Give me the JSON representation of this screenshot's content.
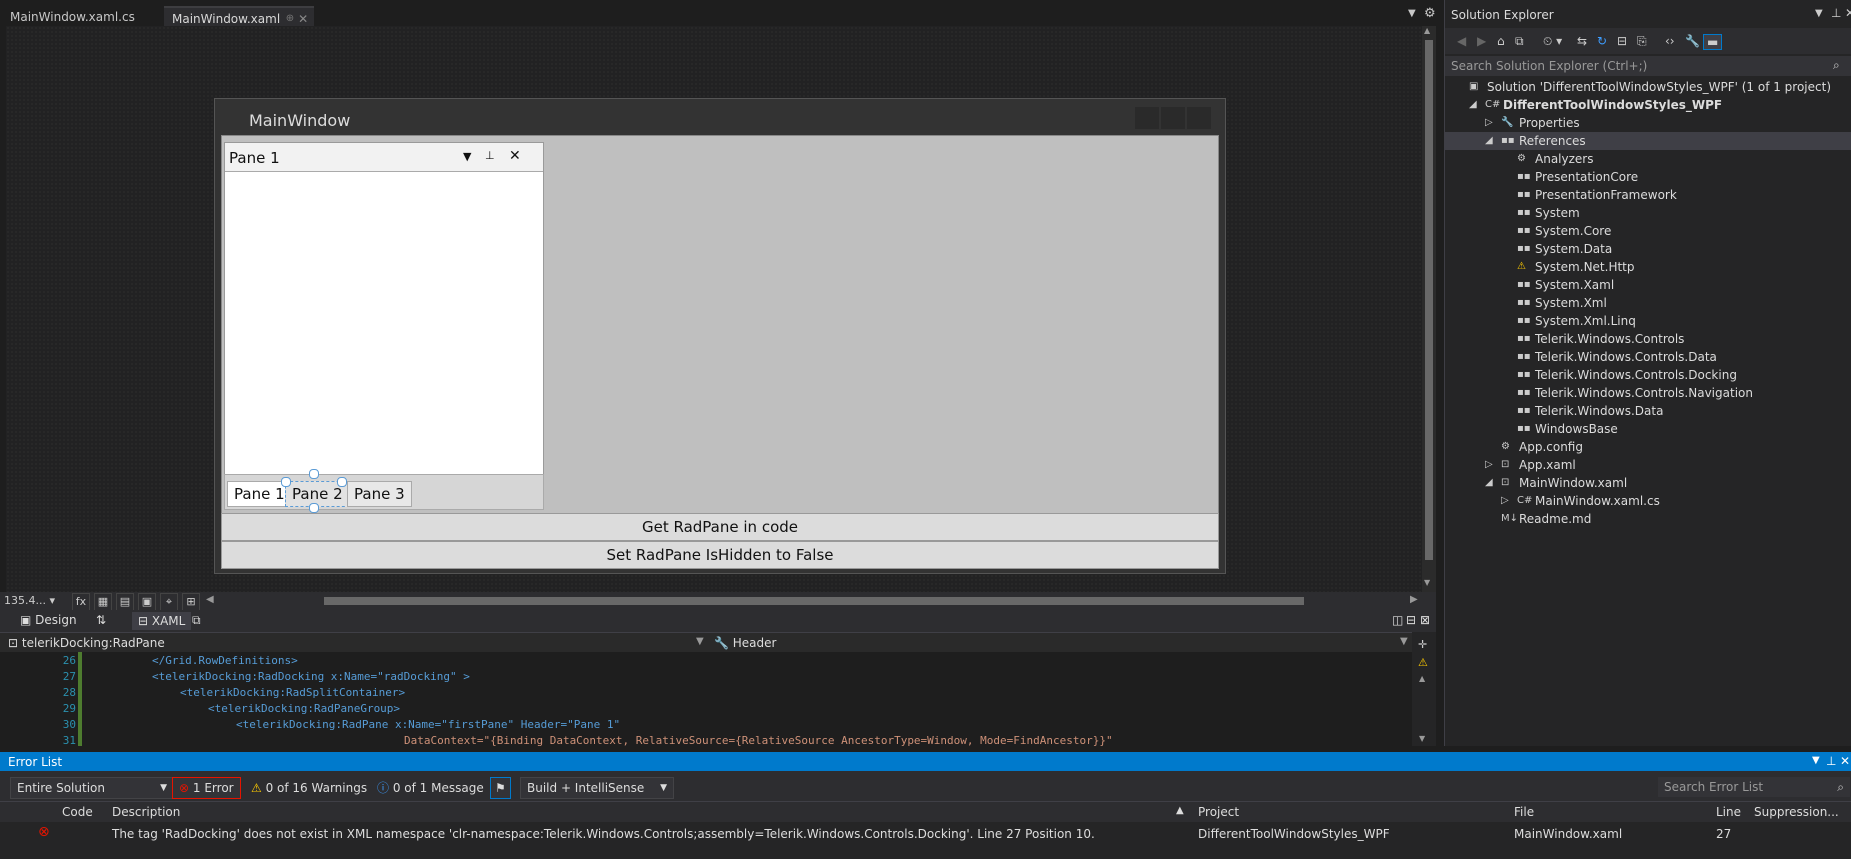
{
  "tabs": [
    {
      "label": "MainWindow.xaml.cs"
    },
    {
      "label": "MainWindow.xaml",
      "pin": "⊕",
      "close": "✕"
    }
  ],
  "designer": {
    "window_title": "MainWindow",
    "pane": {
      "title": "Pane 1",
      "menu": "▼",
      "pin": "📌",
      "close": "✕"
    },
    "pane_tabs": [
      "Pane 1",
      "Pane 2",
      "Pane 3"
    ],
    "buttons": [
      "Get RadPane in code",
      "Set RadPane IsHidden to False"
    ]
  },
  "zoom": "135.4...",
  "view_tabs": {
    "design": "Design",
    "swap": "⇅",
    "xaml": "XAML"
  },
  "path_bar": {
    "element": "telerikDocking:RadPane",
    "property": "Header"
  },
  "code_lines": [
    {
      "num": "26",
      "text": "</Grid.RowDefinitions>"
    },
    {
      "num": "27",
      "text": "<telerikDocking:RadDocking x:Name=\"radDocking\" >"
    },
    {
      "num": "28",
      "text": "<telerikDocking:RadSplitContainer>"
    },
    {
      "num": "29",
      "text": "<telerikDocking:RadPaneGroup>"
    },
    {
      "num": "30",
      "text": "<telerikDocking:RadPane x:Name=\"firstPane\" Header=\"Pane 1\""
    },
    {
      "num": "31",
      "text": "DataContext=\"{Binding DataContext, RelativeSource={RelativeSource AncestorType=Window, Mode=FindAncestor}}\""
    }
  ],
  "solution_explorer": {
    "title": "Solution Explorer",
    "search_placeholder": "Search Solution Explorer (Ctrl+;)",
    "tree": [
      {
        "label": "Solution 'DifferentToolWindowStyles_WPF' (1 of 1 project)",
        "level": 0,
        "icon": "solution-icon",
        "expander": ""
      },
      {
        "label": "DifferentToolWindowStyles_WPF",
        "level": 1,
        "icon": "csharp-project-icon",
        "expander": "◢",
        "bold": true
      },
      {
        "label": "Properties",
        "level": 2,
        "icon": "wrench-icon",
        "expander": "▷"
      },
      {
        "label": "References",
        "level": 2,
        "icon": "references-icon",
        "expander": "◢",
        "selected": true
      },
      {
        "label": "Analyzers",
        "level": 3,
        "icon": "analyzer-icon",
        "expander": ""
      },
      {
        "label": "PresentationCore",
        "level": 3,
        "icon": "reference-icon",
        "expander": ""
      },
      {
        "label": "PresentationFramework",
        "level": 3,
        "icon": "reference-icon",
        "expander": ""
      },
      {
        "label": "System",
        "level": 3,
        "icon": "reference-icon",
        "expander": ""
      },
      {
        "label": "System.Core",
        "level": 3,
        "icon": "reference-icon",
        "expander": ""
      },
      {
        "label": "System.Data",
        "level": 3,
        "icon": "reference-icon",
        "expander": ""
      },
      {
        "label": "System.Net.Http",
        "level": 3,
        "icon": "warning-reference-icon",
        "expander": ""
      },
      {
        "label": "System.Xaml",
        "level": 3,
        "icon": "reference-icon",
        "expander": ""
      },
      {
        "label": "System.Xml",
        "level": 3,
        "icon": "reference-icon",
        "expander": ""
      },
      {
        "label": "System.Xml.Linq",
        "level": 3,
        "icon": "reference-icon",
        "expander": ""
      },
      {
        "label": "Telerik.Windows.Controls",
        "level": 3,
        "icon": "reference-icon",
        "expander": ""
      },
      {
        "label": "Telerik.Windows.Controls.Data",
        "level": 3,
        "icon": "reference-icon",
        "expander": ""
      },
      {
        "label": "Telerik.Windows.Controls.Docking",
        "level": 3,
        "icon": "reference-icon",
        "expander": ""
      },
      {
        "label": "Telerik.Windows.Controls.Navigation",
        "level": 3,
        "icon": "reference-icon",
        "expander": ""
      },
      {
        "label": "Telerik.Windows.Data",
        "level": 3,
        "icon": "reference-icon",
        "expander": ""
      },
      {
        "label": "WindowsBase",
        "level": 3,
        "icon": "reference-icon",
        "expander": ""
      },
      {
        "label": "App.config",
        "level": 2,
        "icon": "config-file-icon",
        "expander": ""
      },
      {
        "label": "App.xaml",
        "level": 2,
        "icon": "xaml-file-icon",
        "expander": "▷"
      },
      {
        "label": "MainWindow.xaml",
        "level": 2,
        "icon": "xaml-file-icon",
        "expander": "◢"
      },
      {
        "label": "MainWindow.xaml.cs",
        "level": 3,
        "icon": "csharp-file-icon",
        "expander": "▷"
      },
      {
        "label": "Readme.md",
        "level": 2,
        "icon": "markdown-file-icon",
        "expander": ""
      }
    ]
  },
  "error_list": {
    "title": "Error List",
    "scope": "Entire Solution",
    "errors_label": "1 Error",
    "warnings_label": "0 of 16 Warnings",
    "messages_label": "0 of 1 Message",
    "build_filter": "Build + IntelliSense",
    "search_placeholder": "Search Error List",
    "columns": {
      "code": "Code",
      "description": "Description",
      "project": "Project",
      "file": "File",
      "line": "Line",
      "suppression": "Suppression..."
    },
    "rows": [
      {
        "code": "",
        "description": "The tag 'RadDocking' does not exist in XML namespace 'clr-namespace:Telerik.Windows.Controls;assembly=Telerik.Windows.Controls.Docking'. Line 27 Position 10.",
        "project": "DifferentToolWindowStyles_WPF",
        "file": "MainWindow.xaml",
        "line": "27",
        "suppression": ""
      }
    ]
  },
  "colors": {
    "accent": "#007acc",
    "error": "#e51400",
    "warning": "#ffcc00"
  }
}
